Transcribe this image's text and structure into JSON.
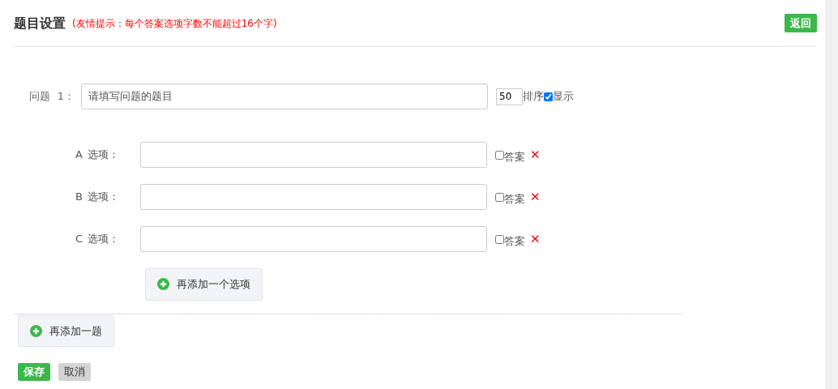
{
  "header": {
    "title": "题目设置",
    "tip": "(友情提示：每个答案选项字数不能超过16个字)",
    "back_button": "返回"
  },
  "question": {
    "label": "问题  1：",
    "value": "请填写问题的题目",
    "order_value": "50",
    "order_label": "排序",
    "show_label": "显示",
    "show_checked": true
  },
  "options": [
    {
      "letter": "A",
      "label": "选项：",
      "answer_label": "答案",
      "answer_checked": false,
      "delete": "✕"
    },
    {
      "letter": "B",
      "label": "选项：",
      "answer_label": "答案",
      "answer_checked": false,
      "delete": "✕"
    },
    {
      "letter": "C",
      "label": "选项：",
      "answer_label": "答案",
      "answer_checked": false,
      "delete": "✕"
    }
  ],
  "add_option_button": "再添加一个选项",
  "add_question_button": "再添加一题",
  "footer_buttons": [
    {
      "label": "保存",
      "kind": "primary"
    },
    {
      "label": "取消",
      "kind": "secondary"
    }
  ]
}
